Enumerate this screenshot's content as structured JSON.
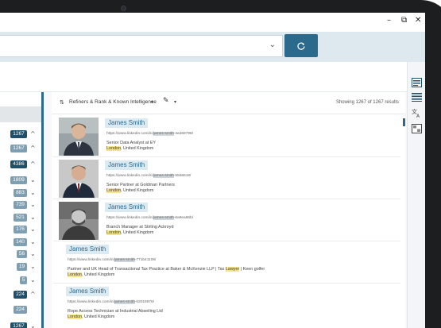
{
  "window": {
    "minimize": "–",
    "restore": "⧉",
    "close": "✕"
  },
  "search": {
    "value": "",
    "chevron": "⌄",
    "go_icon": "refresh-icon"
  },
  "colors": {
    "accent": "#2b6a8c",
    "badge_dark": "#1f4f6a",
    "badge_light": "#7d9fb3",
    "highlight": "#f5e38c"
  },
  "facets": [
    {
      "count": "1267",
      "style": "dark",
      "state": "^"
    },
    {
      "count": "1267",
      "style": "light",
      "state": "^"
    },
    {
      "count": "4386",
      "style": "dark",
      "state": "^"
    },
    {
      "count": "1809",
      "style": "light",
      "state": "⌄"
    },
    {
      "count": "883",
      "style": "light",
      "state": "⌄"
    },
    {
      "count": "739",
      "style": "light",
      "state": "⌄"
    },
    {
      "count": "521",
      "style": "light",
      "state": "⌄"
    },
    {
      "count": "176",
      "style": "light",
      "state": "⌄"
    },
    {
      "count": "140",
      "style": "light",
      "state": "⌄"
    },
    {
      "count": "56",
      "style": "light",
      "state": "⌄"
    },
    {
      "count": "19",
      "style": "light",
      "state": "⌄"
    },
    {
      "count": "5",
      "style": "light",
      "state": "⌄"
    },
    {
      "count": "224",
      "style": "dark",
      "state": "^"
    },
    {
      "count": "224",
      "style": "light",
      "state": ""
    },
    {
      "count": "1267",
      "style": "dark",
      "state": "⌄"
    }
  ],
  "toolbar": {
    "sort_icon": "⇅",
    "refiners_label": "Refiners & Rank & Known Intelligence",
    "chevron": "▾",
    "pen_icon": "✎",
    "status": "Showing 1267 of 1267 results"
  },
  "results": [
    {
      "name": "James Smith",
      "url_prefix": "https://www.linkedin.com/in/",
      "url_match": "james-smith",
      "url_suffix": "-4a369798/",
      "line1": "Senior Data Analyst at EY",
      "loc_city": "London",
      "loc_rest": ", United Kingdom",
      "has_photo": true
    },
    {
      "name": "James Smith",
      "url_prefix": "https://www.linkedin.com/in/",
      "url_match": "james-smith",
      "url_suffix": "-5556618/",
      "line1": "Senior Partner at Goldman Partners",
      "loc_city": "London",
      "loc_rest": ", United Kingdom",
      "has_photo": true
    },
    {
      "name": "James Smith",
      "url_prefix": "https://www.linkedin.com/in/",
      "url_match": "james-smith",
      "url_suffix": "-6a9ea86b/",
      "line1": "Branch Manager at Stirling Ackroyd",
      "loc_city": "London",
      "loc_rest": ", United Kingdom",
      "has_photo": true
    },
    {
      "name": "James Smith",
      "url_prefix": "https://www.linkedin.com/in/",
      "url_match": "james-smith",
      "url_suffix": "-771b41106/",
      "line1": "Partner and UK Head of Transactional Tax Practice at Baker & McKenzie LLP | Tax ",
      "line1_match": "Lawyer",
      "line1_tail": " | Keen golfer",
      "loc_city": "London",
      "loc_rest": ", United Kingdom",
      "has_photo": false
    },
    {
      "name": "James Smith",
      "url_prefix": "https://www.linkedin.com/in/",
      "url_match": "james-smith",
      "url_suffix": "-63018976/",
      "line1": "Rope Access Technician at Industrial Abseiling Ltd",
      "loc_city": "London",
      "loc_rest": ", United Kingdom",
      "has_photo": false
    }
  ],
  "rail_icons": [
    "panel-icon",
    "list-icon",
    "translate-icon",
    "grid-icon"
  ]
}
